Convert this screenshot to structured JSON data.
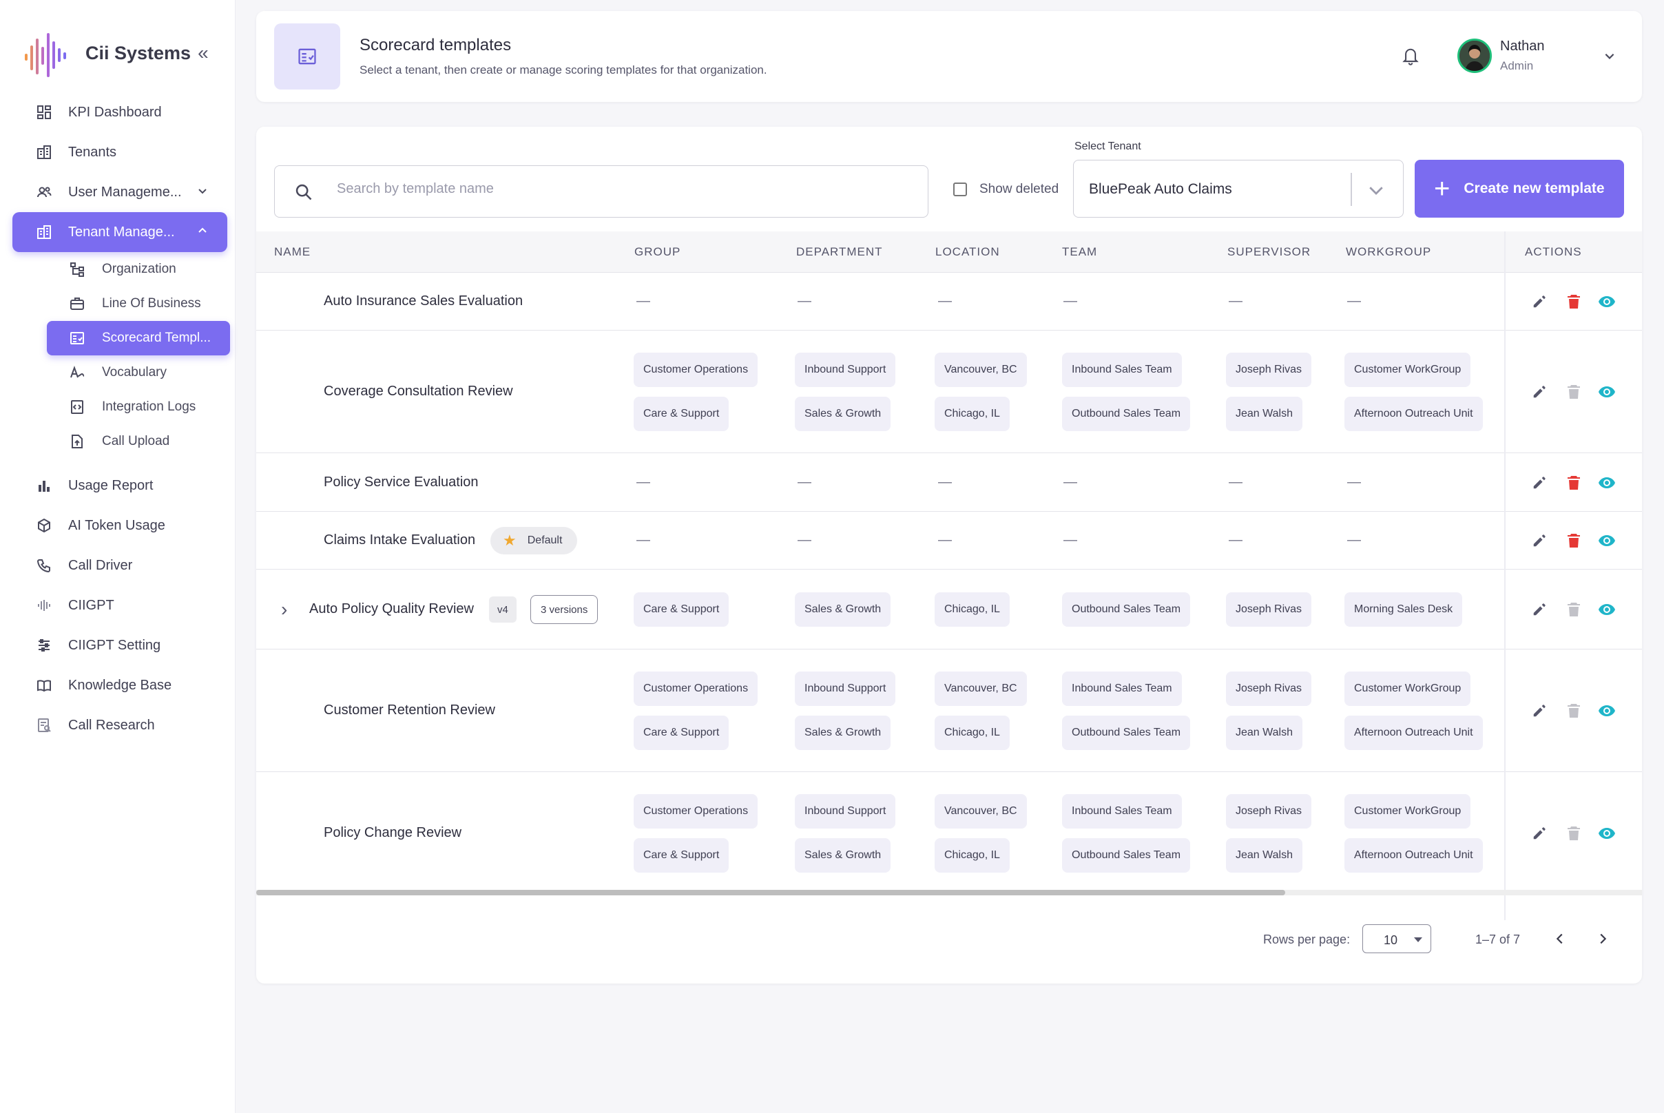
{
  "brand": {
    "name": "Cii Systems",
    "collapse_glyph": "«"
  },
  "sidebar": {
    "items": [
      {
        "label": "KPI Dashboard",
        "icon": "dashboard-icon"
      },
      {
        "label": "Tenants",
        "icon": "building-icon"
      },
      {
        "label": "User Manageme...",
        "icon": "users-icon",
        "chevron": "down"
      },
      {
        "label": "Tenant Manage...",
        "icon": "tenant-icon",
        "chevron": "up",
        "active": true
      },
      {
        "label": "Usage Report",
        "icon": "bar-chart-icon"
      },
      {
        "label": "AI Token Usage",
        "icon": "cube-icon"
      },
      {
        "label": "Call Driver",
        "icon": "phone-icon"
      },
      {
        "label": "CIIGPT",
        "icon": "ciigpt-icon"
      },
      {
        "label": "CIIGPT Setting",
        "icon": "sliders-icon"
      },
      {
        "label": "Knowledge Base",
        "icon": "book-icon"
      },
      {
        "label": "Call Research",
        "icon": "research-icon"
      }
    ],
    "sub_items": [
      {
        "label": "Organization",
        "icon": "org-chart-icon"
      },
      {
        "label": "Line Of Business",
        "icon": "briefcase-icon"
      },
      {
        "label": "Scorecard Templ...",
        "icon": "scorecard-icon",
        "active": true
      },
      {
        "label": "Vocabulary",
        "icon": "vocabulary-icon"
      },
      {
        "label": "Integration Logs",
        "icon": "code-file-icon"
      },
      {
        "label": "Call Upload",
        "icon": "upload-file-icon"
      }
    ]
  },
  "header": {
    "title": "Scorecard templates",
    "subtitle": "Select a tenant, then create or manage scoring templates for that organization.",
    "user": {
      "name": "Nathan",
      "role": "Admin"
    }
  },
  "toolbar": {
    "search_placeholder": "Search by template name",
    "show_deleted_label": "Show deleted",
    "tenant_label": "Select Tenant",
    "tenant_value": "BluePeak Auto Claims",
    "create_label": "Create new template"
  },
  "table": {
    "columns": [
      "NAME",
      "GROUP",
      "DEPARTMENT",
      "LOCATION",
      "TEAM",
      "SUPERVISOR",
      "WORKGROUP",
      "ACTIONS"
    ],
    "empty_glyph": "—",
    "rows": [
      {
        "name": "Auto Insurance Sales Evaluation",
        "empty": true,
        "delete_enabled": true
      },
      {
        "name": "Coverage Consultation Review",
        "delete_enabled": false,
        "group": [
          "Customer Operations",
          "Care & Support"
        ],
        "department": [
          "Inbound Support",
          "Sales & Growth"
        ],
        "location": [
          "Vancouver, BC",
          "Chicago, IL"
        ],
        "team": [
          "Inbound Sales Team",
          "Outbound Sales Team"
        ],
        "supervisor": [
          "Joseph Rivas",
          "Jean Walsh"
        ],
        "workgroup": [
          "Customer WorkGroup",
          "Afternoon Outreach Unit"
        ]
      },
      {
        "name": "Policy Service Evaluation",
        "empty": true,
        "delete_enabled": true
      },
      {
        "name": "Claims Intake Evaluation",
        "empty": true,
        "delete_enabled": true,
        "badge": "Default"
      },
      {
        "name": "Auto Policy Quality Review",
        "delete_enabled": false,
        "version": "v4",
        "versions": "3 versions",
        "group": [
          "Care & Support"
        ],
        "department": [
          "Sales & Growth"
        ],
        "location": [
          "Chicago, IL"
        ],
        "team": [
          "Outbound Sales Team"
        ],
        "supervisor": [
          "Joseph Rivas"
        ],
        "workgroup": [
          "Morning Sales Desk"
        ]
      },
      {
        "name": "Customer Retention Review",
        "delete_enabled": false,
        "group": [
          "Customer Operations",
          "Care & Support"
        ],
        "department": [
          "Inbound Support",
          "Sales & Growth"
        ],
        "location": [
          "Vancouver, BC",
          "Chicago, IL"
        ],
        "team": [
          "Inbound Sales Team",
          "Outbound Sales Team"
        ],
        "supervisor": [
          "Joseph Rivas",
          "Jean Walsh"
        ],
        "workgroup": [
          "Customer WorkGroup",
          "Afternoon Outreach Unit"
        ]
      },
      {
        "name": "Policy Change Review",
        "delete_enabled": false,
        "group": [
          "Customer Operations",
          "Care & Support"
        ],
        "department": [
          "Inbound Support",
          "Sales & Growth"
        ],
        "location": [
          "Vancouver, BC",
          "Chicago, IL"
        ],
        "team": [
          "Inbound Sales Team",
          "Outbound Sales Team"
        ],
        "supervisor": [
          "Joseph Rivas",
          "Jean Walsh"
        ],
        "workgroup": [
          "Customer WorkGroup",
          "Afternoon Outreach Unit"
        ]
      }
    ]
  },
  "pagination": {
    "rows_label": "Rows per page:",
    "rows_value": "10",
    "range": "1–7 of 7"
  },
  "colors": {
    "accent": "#7b6cf0",
    "delete": "#e53935",
    "view": "#1fb5c9",
    "avatar_ring": "#1fbf7a"
  }
}
